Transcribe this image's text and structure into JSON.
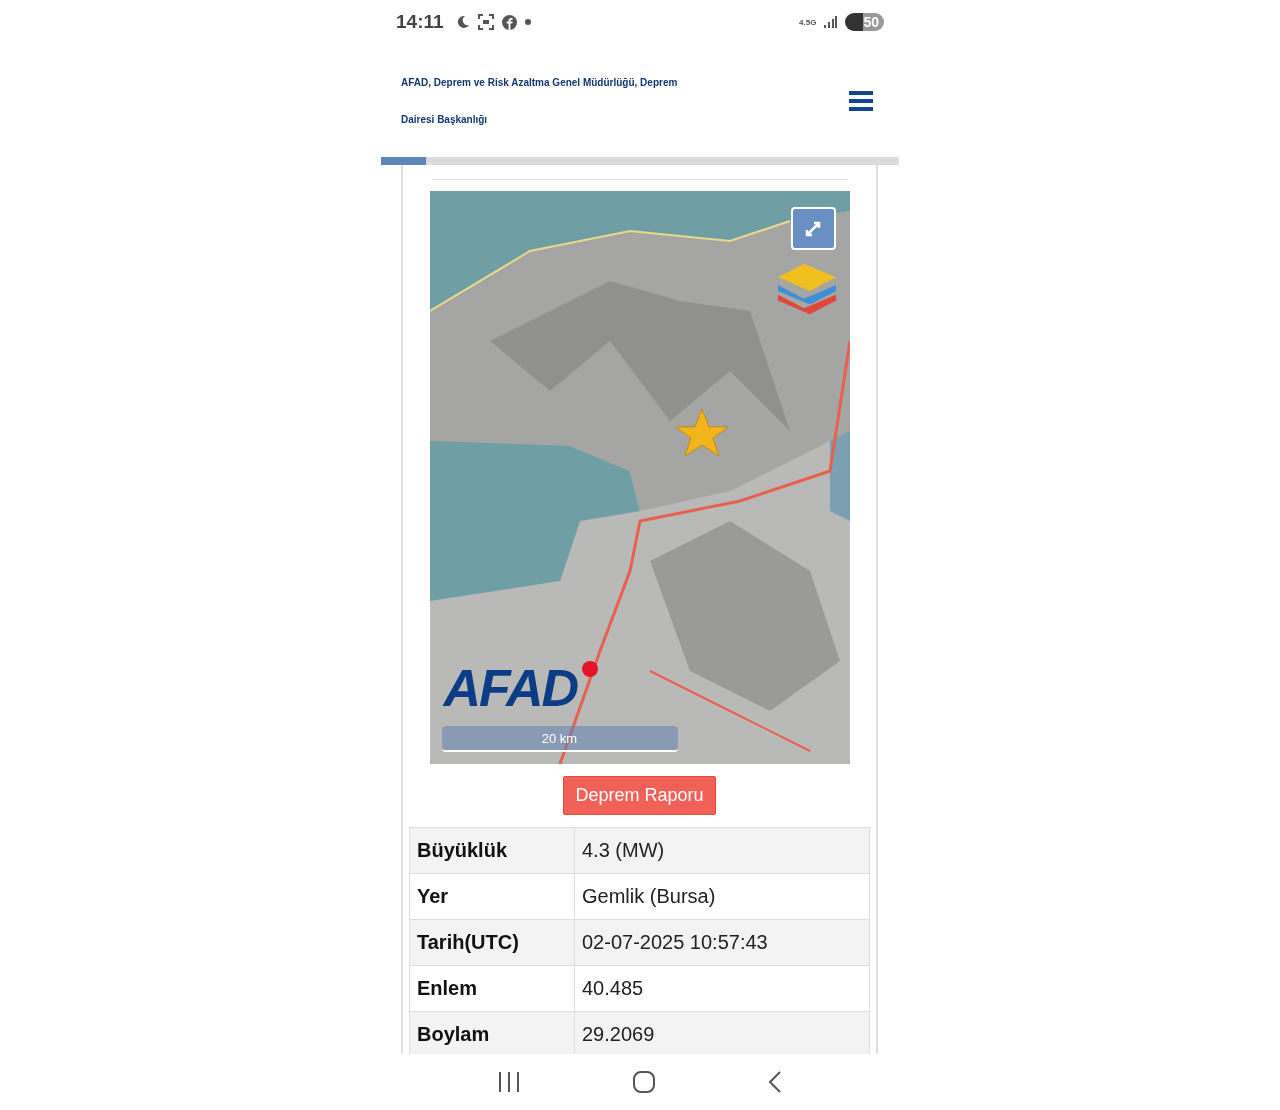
{
  "status_bar": {
    "time": "14:11",
    "network": "4.5G",
    "battery": "50"
  },
  "header": {
    "title": "AFAD, Deprem ve Risk Azaltma Genel Müdürlüğü, Deprem",
    "title_line_2": "Dairesi Başkanlığı"
  },
  "progress": {
    "level": 0.087
  },
  "map": {
    "kind": "picture",
    "logo": "AFAD",
    "scale": "20 km"
  },
  "report_button": "Deprem Raporu",
  "details": [
    {
      "label": "Büyüklük",
      "value": "4.3 (MW)"
    },
    {
      "label": "Yer",
      "value": "Gemlik (Bursa)"
    },
    {
      "label": "Tarih(UTC)",
      "value": "02-07-2025 10:57:43"
    },
    {
      "label": "Enlem",
      "value": "40.485"
    },
    {
      "label": "Boylam",
      "value": "29.2069"
    }
  ]
}
